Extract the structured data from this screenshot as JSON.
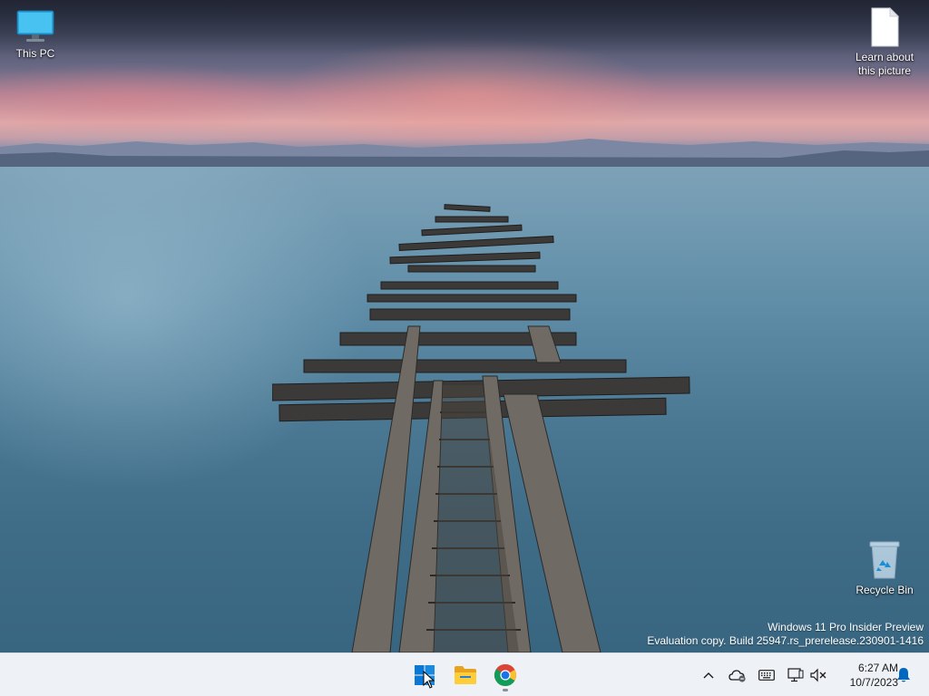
{
  "desktop": {
    "icons": [
      {
        "label": "This PC",
        "icon": "monitor-icon"
      },
      {
        "label": "Learn about this picture",
        "icon": "document-icon"
      },
      {
        "label": "Recycle Bin",
        "icon": "recycle-bin-icon"
      }
    ],
    "watermark": {
      "line1": "Windows 11 Pro Insider Preview",
      "line2": "Evaluation copy. Build 25947.rs_prerelease.230901-1416"
    }
  },
  "taskbar": {
    "apps": [
      {
        "name": "start",
        "icon": "windows-logo-icon"
      },
      {
        "name": "file-explorer",
        "icon": "folder-icon"
      },
      {
        "name": "chrome",
        "icon": "chrome-icon"
      }
    ],
    "tray": [
      {
        "icon": "chevron-up-icon"
      },
      {
        "icon": "onedrive-icon"
      },
      {
        "icon": "keyboard-icon"
      },
      {
        "icon": "network-icon"
      },
      {
        "icon": "volume-muted-icon"
      },
      {
        "icon": "notification-bell-icon"
      }
    ],
    "clock": {
      "time": "6:27 AM",
      "date": "10/7/2023"
    }
  },
  "colors": {
    "taskbar_bg": "#eef1f5",
    "accent": "#0067c0"
  }
}
